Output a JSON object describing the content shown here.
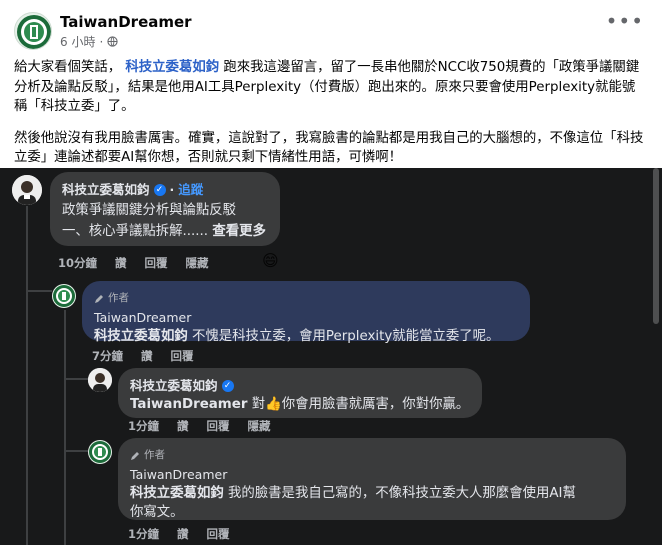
{
  "post": {
    "author": "TaiwanDreamer",
    "time": "6 小時",
    "more": "•••",
    "paragraph1_pre": "給大家看個笑話，",
    "paragraph1_link": "科技立委葛如鈞",
    "paragraph1_post": "跑來我這邊留言，留了一長串他關於NCC收750規費的「政策爭議關鍵分析及論點反駁」，結果是他用AI工具Perplexity（付費版）跑出來的。原來只要會使用Perplexity就能號稱「科技立委」了。",
    "paragraph2": "然後他說沒有我用臉書厲害。確實，這說對了，我寫臉書的論點都是用我自己的大腦想的，不像這位「科技立委」連論述都要AI幫你想，否則就只剩下情緒性用語，可憐啊！"
  },
  "comments": [
    {
      "name": "科技立委葛如鈞",
      "follow": "追蹤",
      "line1": "政策爭議關鍵分析與論點反駁",
      "line2": "一、核心爭議點拆解......",
      "see_more": "查看更多",
      "time": "10分鐘",
      "like": "讚",
      "reply": "回覆",
      "hide": "隱藏",
      "emoji": "😄"
    },
    {
      "author_tag": "作者",
      "name": "TaiwanDreamer",
      "mention": "科技立委葛如鈞",
      "text": "不愧是科技立委，會用Perplexity就能當立委了呢。",
      "time": "7分鐘",
      "like": "讚",
      "reply": "回覆"
    },
    {
      "name": "科技立委葛如鈞",
      "mention": "TaiwanDreamer",
      "text_pre": "對",
      "emoji": "👍",
      "text_post": "你會用臉書就厲害，你對你贏。",
      "time": "1分鐘",
      "like": "讚",
      "reply": "回覆",
      "hide": "隱藏"
    },
    {
      "author_tag": "作者",
      "name": "TaiwanDreamer",
      "mention": "科技立委葛如鈞",
      "text_line1": "我的臉書是我自己寫的，不像科技立委大人那麼會使用AI幫",
      "text_line2": "你寫文。",
      "time": "1分鐘",
      "like": "讚",
      "reply": "回覆"
    }
  ],
  "colors": {
    "link": "#2d62c8",
    "dark_bg": "#18191a",
    "bubble": "#3a3b3c",
    "author_bubble": "#2e3a5c",
    "follow": "#4599ff"
  }
}
